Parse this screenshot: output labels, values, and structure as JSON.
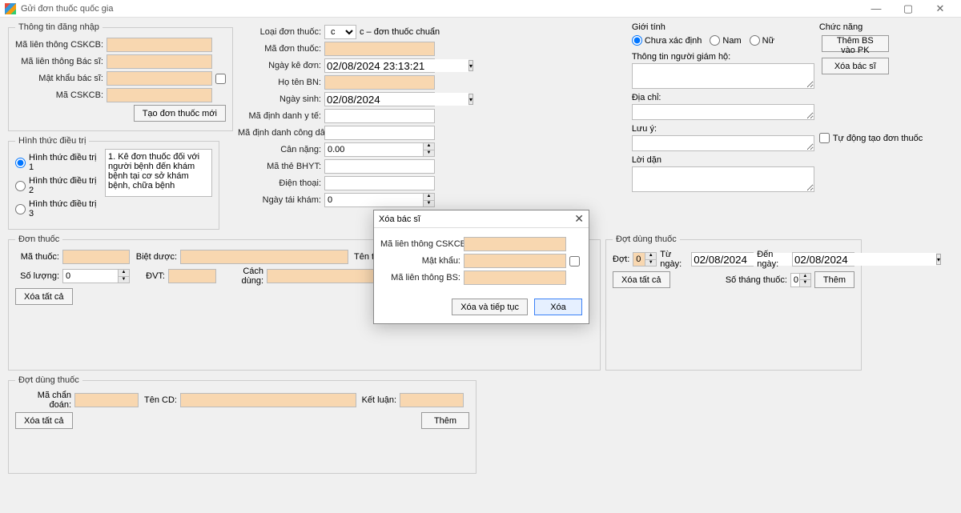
{
  "window": {
    "title": "Gửi đơn thuốc quốc gia"
  },
  "login": {
    "legend": "Thông tin đăng nhập",
    "cskcb_label": "Mã liên thông CSKCB:",
    "bs_label": "Mã liên thông Bác sĩ:",
    "pw_label": "Mật khẩu bác sĩ:",
    "cskcb2_label": "Mã CSKCB:",
    "create_btn": "Tạo đơn thuốc mới"
  },
  "treat": {
    "legend": "Hình thức điều trị",
    "opt1": "Hình thức điều trị 1",
    "opt2": "Hình thức điều trị 2",
    "opt3": "Hình thức điều trị 3",
    "hint": "1. Kê đơn thuốc đối với người bệnh đến khám bệnh tại cơ sở khám bệnh, chữa bệnh"
  },
  "rx": {
    "type_label": "Loại đơn thuốc:",
    "type_value": "c",
    "type_hint": "c – đơn thuốc chuẩn",
    "code_label": "Mã đơn thuốc:",
    "date_label": "Ngày kê đơn:",
    "date_value": "02/08/2024 23:13:21",
    "name_label": "Họ tên BN:",
    "dob_label": "Ngày sinh:",
    "dob_value": "02/08/2024",
    "id_label": "Mã định danh y tế:",
    "cid_label": "Mã định danh công dân:",
    "weight_label": "Cân nặng:",
    "weight_value": "0.00",
    "bhyt_label": "Mã thẻ BHYT:",
    "phone_label": "Điện thoại:",
    "revisit_label": "Ngày tái khám:",
    "revisit_value": "0"
  },
  "sex": {
    "legend": "Giới tính",
    "unknown": "Chưa xác định",
    "male": "Nam",
    "female": "Nữ",
    "guardian": "Thông tin người giám hộ:",
    "address": "Địa chỉ:",
    "note": "Lưu ý:",
    "advice": "Lời dặn"
  },
  "func": {
    "legend": "Chức năng",
    "add_bs": "Thêm BS vào PK",
    "del_bs": "Xóa bác sĩ",
    "auto": "Tự động tạo đơn thuốc"
  },
  "drug": {
    "legend": "Đơn thuốc",
    "code": "Mã thuốc:",
    "biet": "Biệt dược:",
    "ten": "Tên thuốc:",
    "qty": "Số lượng:",
    "qty_val": "0",
    "dvt": "ĐVT:",
    "usage": "Cách dùng:",
    "del_all": "Xóa tất cả"
  },
  "batch": {
    "legend": "Đợt dùng thuốc",
    "dot": "Đợt:",
    "dot_val": "0",
    "from": "Từ ngày:",
    "from_val": "02/08/2024",
    "to": "Đến ngày:",
    "to_val": "02/08/2024",
    "del_all": "Xóa tất cả",
    "so_thang": "Số tháng thuốc:",
    "so_thang_val": "0",
    "add": "Thêm"
  },
  "diag": {
    "legend": "Đợt dùng thuốc",
    "code": "Mã chẩn đoán:",
    "name": "Tên CD:",
    "concl": "Kết luận:",
    "del_all": "Xóa tất cả",
    "add": "Thêm"
  },
  "modal": {
    "title": "Xóa bác sĩ",
    "cskcb": "Mã liên thông CSKCB:",
    "pw": "Mật khẩu:",
    "bs": "Mã liên thông BS:",
    "cont": "Xóa và tiếp tục",
    "del": "Xóa"
  }
}
